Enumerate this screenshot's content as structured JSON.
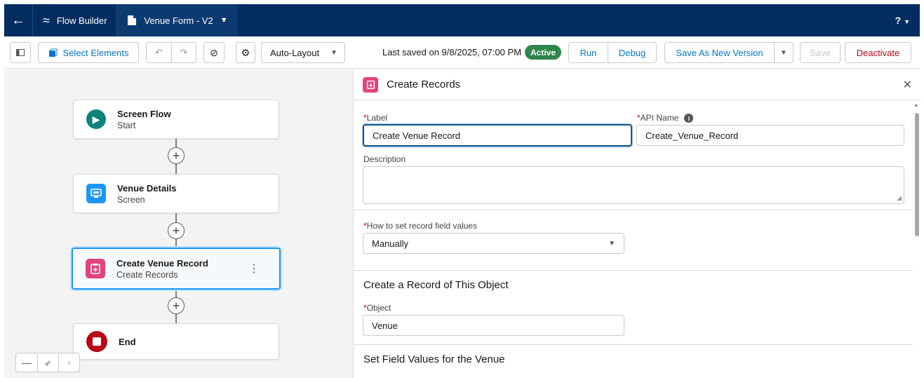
{
  "header": {
    "app_title": "Flow Builder",
    "tab_title": "Venue Form - V2",
    "help_label": "?"
  },
  "toolbar": {
    "select_elements": "Select Elements",
    "layout_mode": "Auto-Layout",
    "last_saved": "Last saved on 9/8/2025, 07:00 PM",
    "status": "Active",
    "run": "Run",
    "debug": "Debug",
    "save_as_new_version": "Save As New Version",
    "save": "Save",
    "deactivate": "Deactivate"
  },
  "canvas": {
    "nodes": [
      {
        "title": "Screen Flow",
        "subtitle": "Start"
      },
      {
        "title": "Venue Details",
        "subtitle": "Screen"
      },
      {
        "title": "Create Venue Record",
        "subtitle": "Create Records"
      },
      {
        "title": "End",
        "subtitle": ""
      }
    ],
    "zoom_out": "—",
    "zoom_in": "+"
  },
  "panel": {
    "title": "Create Records",
    "label_label": "Label",
    "label_value": "Create Venue Record",
    "api_name_label": "API Name",
    "api_name_value": "Create_Venue_Record",
    "description_label": "Description",
    "description_value": "",
    "how_to_set_label": "How to set record field values",
    "how_to_set_value": "Manually",
    "object_section": "Create a Record of This Object",
    "object_label": "Object",
    "object_value": "Venue",
    "field_values_section": "Set Field Values for the Venue"
  },
  "colors": {
    "header_bg": "#032d60",
    "brand_blue": "#0176d3",
    "active_green": "#2e844a",
    "deactivate_red": "#ba0517",
    "create_records_pink": "#e3427d",
    "start_teal": "#0b827c",
    "screen_blue": "#1b96ff",
    "end_red": "#ba0517"
  },
  "icons": {
    "back": "arrow-left-icon",
    "app": "flow-icon",
    "tab": "document-icon",
    "start": "play-icon",
    "screen": "screen-icon",
    "create": "create-record-icon",
    "end": "stop-icon"
  }
}
